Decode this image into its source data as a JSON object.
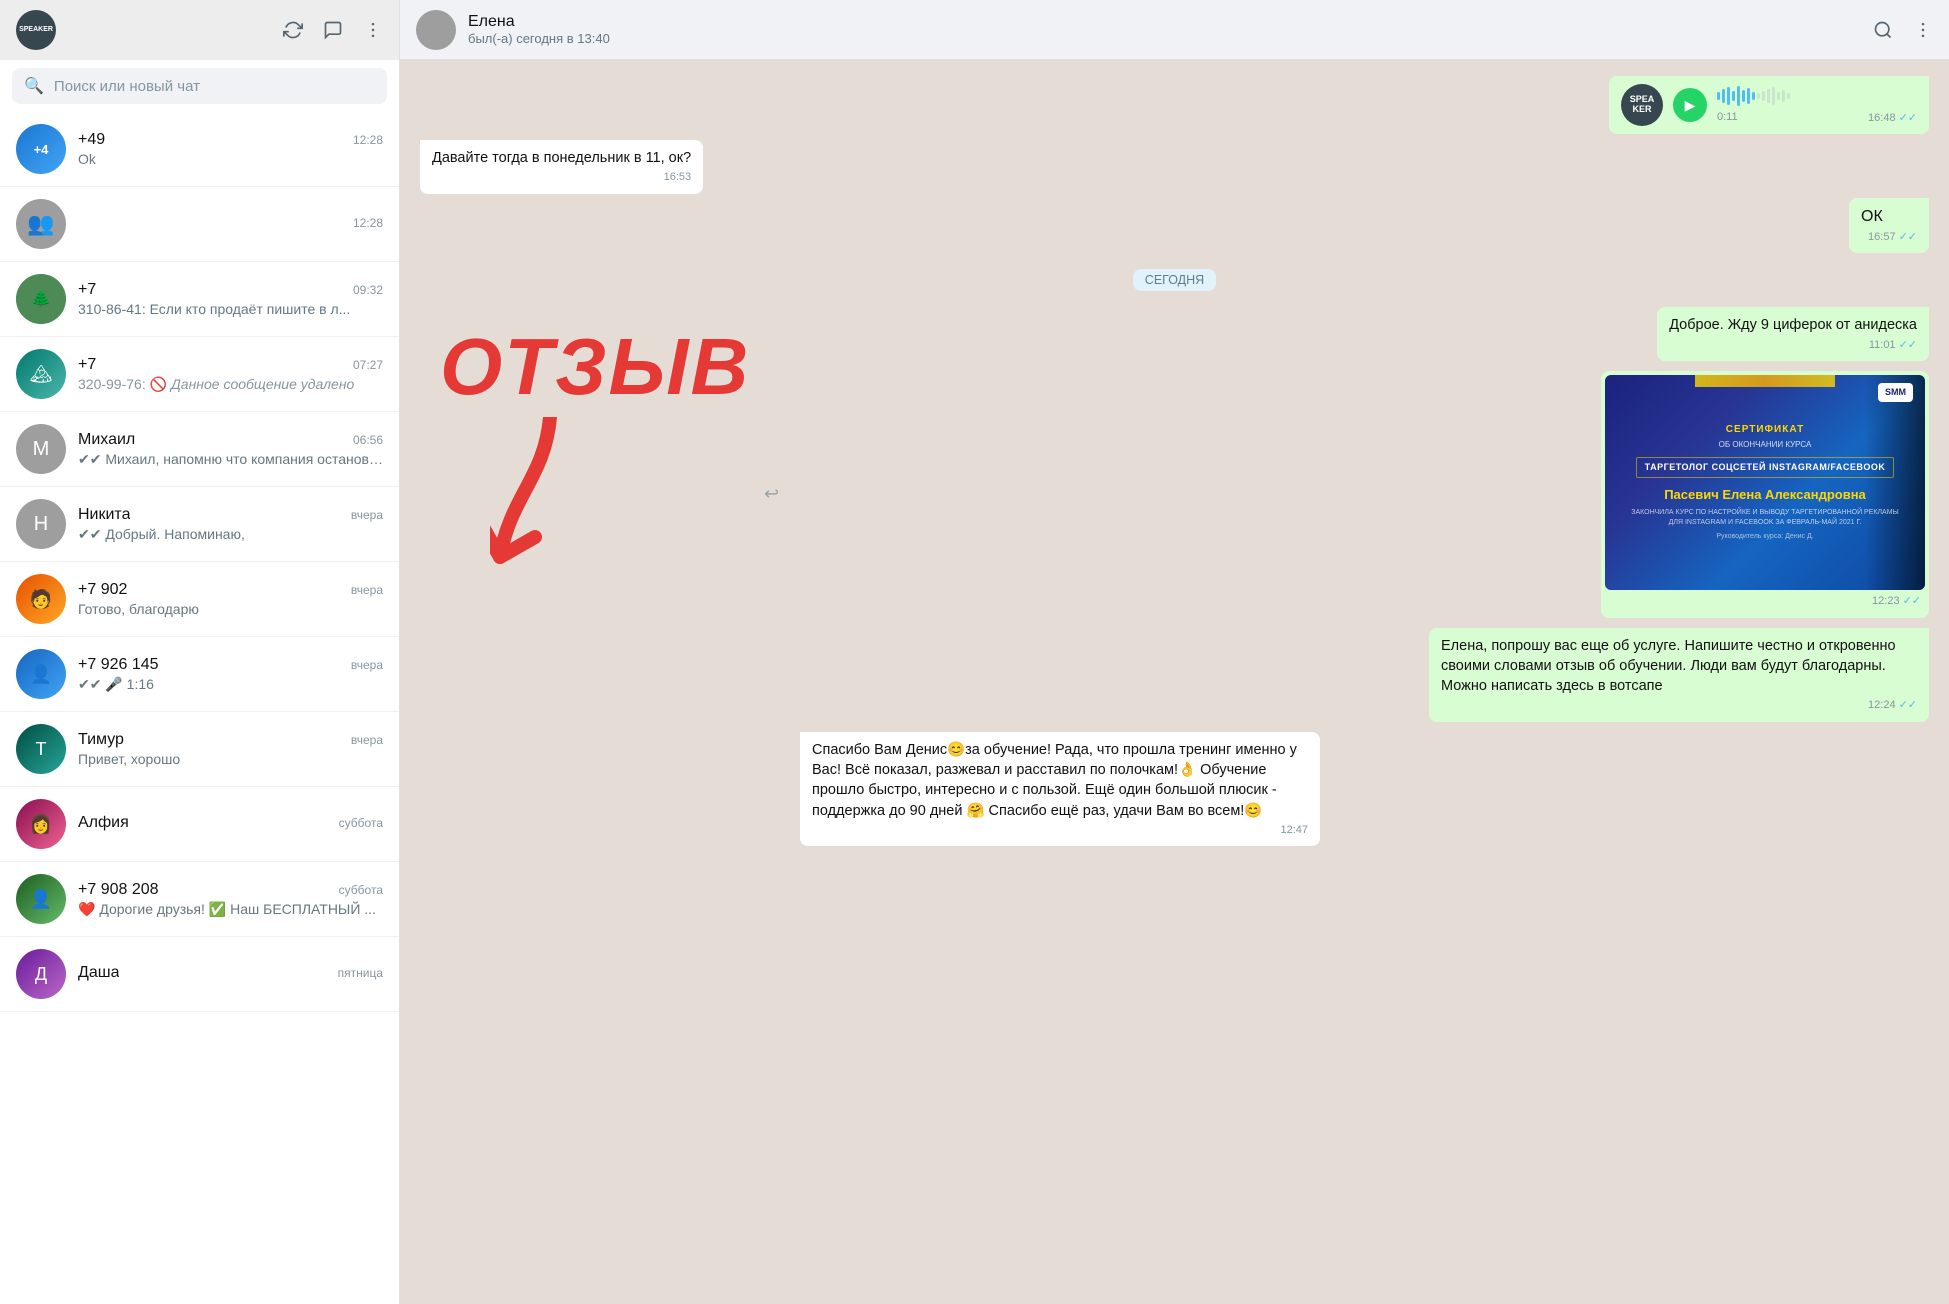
{
  "app": {
    "title": "SPEAKER"
  },
  "sidebar": {
    "header": {
      "logo_text": "SPEAKER"
    },
    "search": {
      "placeholder": "Поиск или новый чат"
    },
    "chats": [
      {
        "id": 1,
        "name": "+49",
        "preview": "Ok",
        "time": "12:28",
        "avatar_color": "blue",
        "avatar_letter": "4"
      },
      {
        "id": 2,
        "name": "",
        "preview": "",
        "time": "12:28",
        "avatar_color": "grey",
        "avatar_letter": "👥",
        "is_group": true
      },
      {
        "id": 3,
        "name": "+7",
        "preview": "310-86-41: Если кто продаёт пишите в л...",
        "time": "09:32",
        "avatar_color": "green",
        "avatar_letter": "+"
      },
      {
        "id": 4,
        "name": "+7",
        "preview": "320-99-76: 🚫 Данное сообщение удалено",
        "time": "07:27",
        "avatar_color": "teal",
        "avatar_letter": "+"
      },
      {
        "id": 5,
        "name": "Михаил",
        "preview": "✔✔ Михаил, напомню что компания остановил...",
        "time": "06:56",
        "avatar_color": "grey",
        "avatar_letter": "М"
      },
      {
        "id": 6,
        "name": "Никита",
        "preview": "✔✔ Добрый. Напоминаю,",
        "time": "вчера",
        "avatar_color": "grey",
        "avatar_letter": "Н"
      },
      {
        "id": 7,
        "name": "+7 902",
        "preview": "Готово, благодарю",
        "time": "вчера",
        "avatar_color": "orange",
        "avatar_letter": "+"
      },
      {
        "id": 8,
        "name": "+7 926 145",
        "preview": "✔✔ 🎤 1:16",
        "time": "вчера",
        "avatar_color": "blue",
        "avatar_letter": "+"
      },
      {
        "id": 9,
        "name": "Тимур",
        "preview": "Привет, хорошо",
        "time": "вчера",
        "avatar_color": "teal",
        "avatar_letter": "Т"
      },
      {
        "id": 10,
        "name": "Алфия",
        "preview": "",
        "time": "суббота",
        "avatar_color": "pink",
        "avatar_letter": "А"
      },
      {
        "id": 11,
        "name": "+7 908 208",
        "preview": "❤️ Дорогие друзья!  ✅ Наш БЕСПЛАТНЫЙ ...",
        "time": "суббота",
        "avatar_color": "green",
        "avatar_letter": "+"
      },
      {
        "id": 12,
        "name": "Даша",
        "preview": "",
        "time": "пятница",
        "avatar_color": "purple",
        "avatar_letter": "Д"
      }
    ]
  },
  "chat": {
    "contact_name": "Елена",
    "contact_status": "был(-а) сегодня в 13:40",
    "messages": [
      {
        "id": 1,
        "type": "audio_outgoing",
        "duration": "0:11",
        "time": "16:48",
        "read": true
      },
      {
        "id": 2,
        "type": "text_incoming",
        "text": "Давайте тогда в понедельник в 11, ок?",
        "time": "16:53"
      },
      {
        "id": 3,
        "type": "text_outgoing",
        "text": "ОК",
        "time": "16:57",
        "read": true
      },
      {
        "id": 4,
        "type": "date_divider",
        "text": "СЕГОДНЯ"
      },
      {
        "id": 5,
        "type": "text_outgoing",
        "text": "Доброе. Жду 9 циферок от анидеска",
        "time": "11:01",
        "read": true
      },
      {
        "id": 6,
        "type": "image_outgoing",
        "caption": "",
        "time": "12:23",
        "read": true,
        "cert": {
          "smm": "SMM",
          "title": "СЕРТИФИКАТ",
          "subtitle": "ОБ ОКОНЧАНИИ КУРСА",
          "course": "ТАРГЕТОЛОГ СОЦСЕТЕЙ INSTAGRAM/FACEBOOK",
          "name": "Пасевич Елена Александровна",
          "desc": "ЗАКОНЧИЛА КУРС ПО НАСТРОЙКЕ И ВЫВОДУ ТАРГЕТИРОВАННОЙ РЕКЛАМЫ ДЛЯ INSTAGRAM И FACEBOOK ЗА ФЕВРАЛЬ-МАЙ 2021 Г.",
          "instructor": "Руководитель курса: Денис Д."
        }
      },
      {
        "id": 7,
        "type": "text_outgoing",
        "text": "Елена, попрошу вас еще об услуге. Напишите честно и откровенно своими словами отзыв об обучении. Люди вам будут благодарны. Можно написать здесь в вотсапе",
        "time": "12:24",
        "read": true
      },
      {
        "id": 8,
        "type": "text_incoming",
        "text": "Спасибо Вам Денис😊за обучение! Рада, что прошла тренинг именно у Вас! Всё показал, разжевал и расставил по полочкам!👌 Обучение прошло быстро, интересно и с пользой. Ещё один большой плюсик - поддержка до 90 дней 🤗 Спасибо ещё раз, удачи Вам во всем!😊",
        "time": "12:47"
      }
    ]
  },
  "otziv": {
    "text": "ОТЗЫВ",
    "arrow": "↓"
  },
  "ok_badge": {
    "text": "OK 1657"
  }
}
